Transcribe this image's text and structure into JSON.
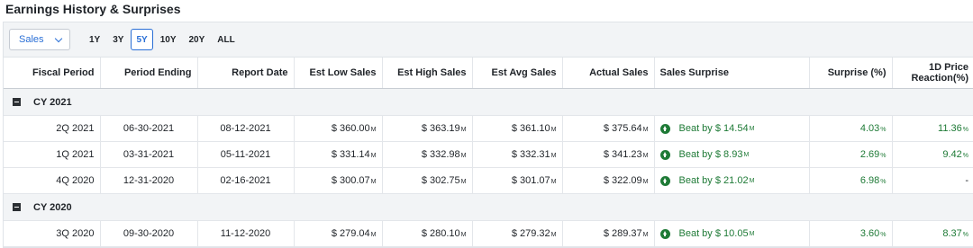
{
  "title": "Earnings History & Surprises",
  "toolbar": {
    "metric_select": "Sales",
    "ranges": [
      "1Y",
      "3Y",
      "5Y",
      "10Y",
      "20Y",
      "ALL"
    ],
    "active_range": "5Y"
  },
  "columns": [
    "Fiscal Period",
    "Period Ending",
    "Report Date",
    "Est Low Sales",
    "Est High Sales",
    "Est Avg Sales",
    "Actual Sales",
    "Sales Surprise",
    "Surprise (%)",
    "1D Price Reaction(%)"
  ],
  "column_header_lines": {
    "price_reaction_1": "1D Price",
    "price_reaction_2": "Reaction(%)"
  },
  "groups": [
    {
      "label": "CY 2021",
      "rows": [
        {
          "period": "2Q 2021",
          "ending": "06-30-2021",
          "report": "08-12-2021",
          "low": "$ 360.00",
          "high": "$ 363.19",
          "avg": "$ 361.10",
          "actual": "$ 375.64",
          "surprise": "Beat by $ 14.54",
          "surprise_pct": "4.03",
          "reaction": "11.36"
        },
        {
          "period": "1Q 2021",
          "ending": "03-31-2021",
          "report": "05-11-2021",
          "low": "$ 331.14",
          "high": "$ 332.98",
          "avg": "$ 332.31",
          "actual": "$ 341.23",
          "surprise": "Beat by $ 8.93",
          "surprise_pct": "2.69",
          "reaction": "9.42"
        },
        {
          "period": "4Q 2020",
          "ending": "12-31-2020",
          "report": "02-16-2021",
          "low": "$ 300.07",
          "high": "$ 302.75",
          "avg": "$ 301.07",
          "actual": "$ 322.09",
          "surprise": "Beat by $ 21.02",
          "surprise_pct": "6.98",
          "reaction": "-"
        }
      ]
    },
    {
      "label": "CY 2020",
      "rows": [
        {
          "period": "3Q 2020",
          "ending": "09-30-2020",
          "report": "11-12-2020",
          "low": "$ 279.04",
          "high": "$ 280.10",
          "avg": "$ 279.32",
          "actual": "$ 289.37",
          "surprise": "Beat by $ 10.05",
          "surprise_pct": "3.60",
          "reaction": "8.37"
        }
      ]
    }
  ],
  "units": {
    "money": "M",
    "percent": "%"
  },
  "colors": {
    "accent": "#2a6fd6",
    "positive": "#1e7a36"
  }
}
